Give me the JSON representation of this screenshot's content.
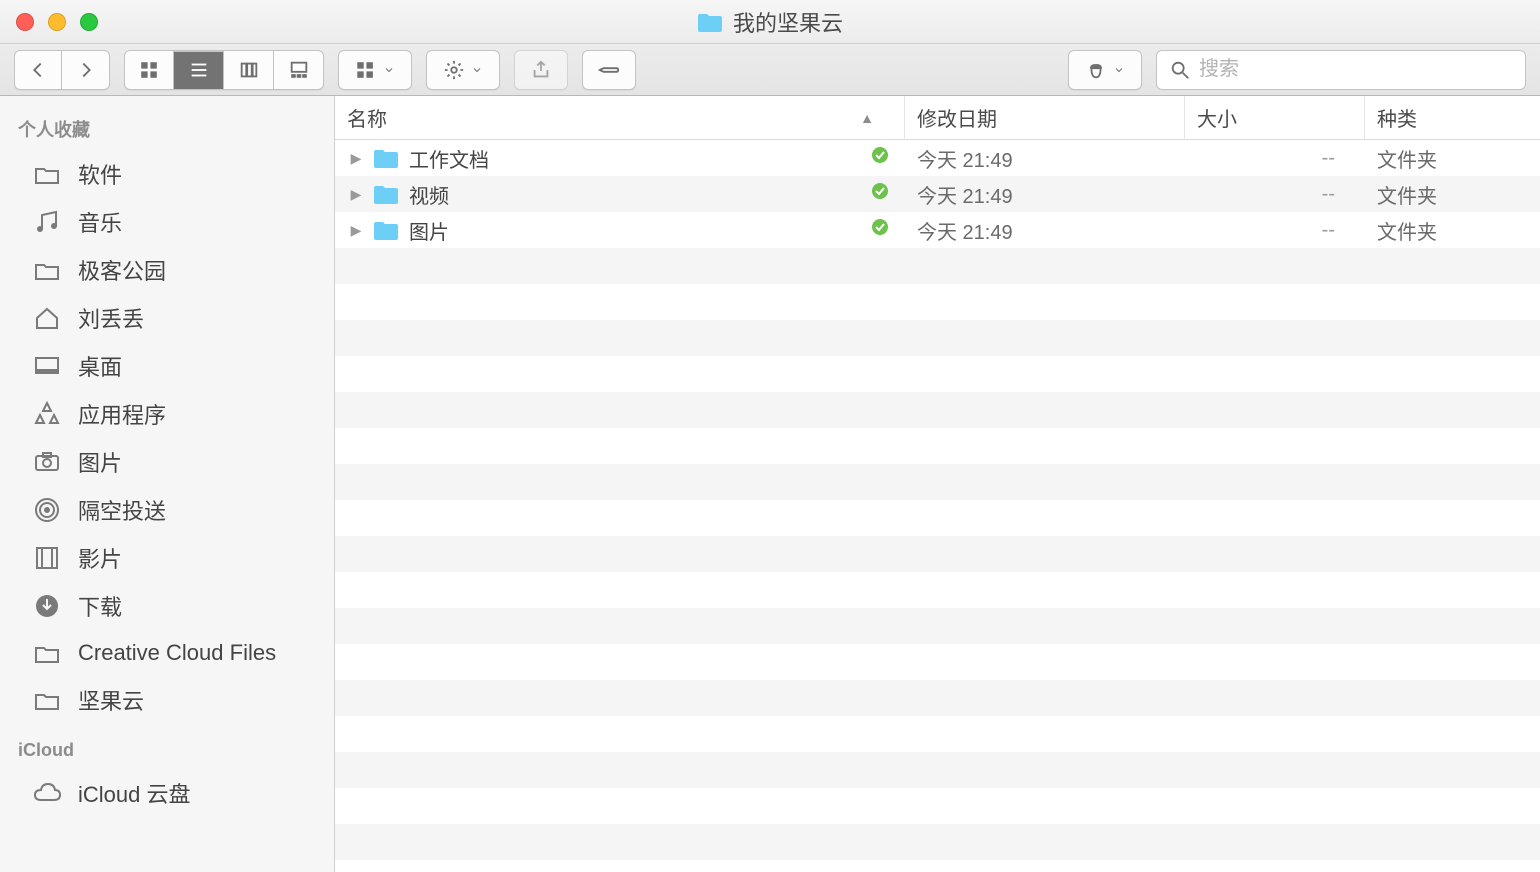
{
  "window": {
    "title": "我的坚果云"
  },
  "search": {
    "placeholder": "搜索"
  },
  "sidebar": {
    "sections": [
      {
        "header": "个人收藏",
        "items": [
          {
            "icon": "folder",
            "label": "软件"
          },
          {
            "icon": "music",
            "label": "音乐"
          },
          {
            "icon": "folder",
            "label": "极客公园"
          },
          {
            "icon": "home",
            "label": "刘丢丢"
          },
          {
            "icon": "desktop",
            "label": "桌面"
          },
          {
            "icon": "apps",
            "label": "应用程序"
          },
          {
            "icon": "camera",
            "label": "图片"
          },
          {
            "icon": "airdrop",
            "label": "隔空投送"
          },
          {
            "icon": "movies",
            "label": "影片"
          },
          {
            "icon": "download",
            "label": "下载"
          },
          {
            "icon": "folder",
            "label": "Creative Cloud Files"
          },
          {
            "icon": "folder",
            "label": "坚果云"
          }
        ]
      },
      {
        "header": "iCloud",
        "items": [
          {
            "icon": "cloud",
            "label": "iCloud 云盘"
          }
        ]
      }
    ]
  },
  "columns": {
    "name": "名称",
    "date": "修改日期",
    "size": "大小",
    "kind": "种类"
  },
  "rows": [
    {
      "name": "工作文档",
      "date": "今天 21:49",
      "size": "--",
      "kind": "文件夹"
    },
    {
      "name": "视频",
      "date": "今天 21:49",
      "size": "--",
      "kind": "文件夹"
    },
    {
      "name": "图片",
      "date": "今天 21:49",
      "size": "--",
      "kind": "文件夹"
    }
  ],
  "colors": {
    "folder": "#6ecff6",
    "sync_ok": "#6cc24a"
  }
}
